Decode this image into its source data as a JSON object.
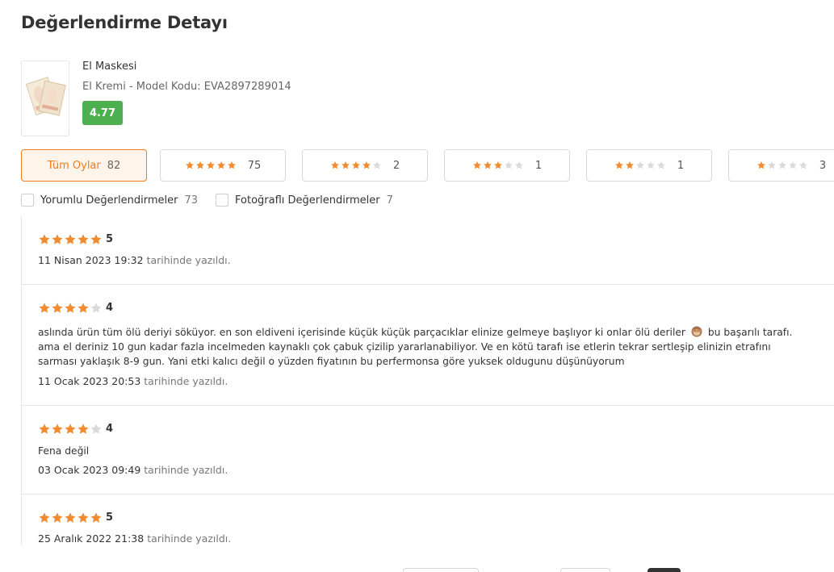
{
  "page": {
    "title": "Değerlendirme Detayı"
  },
  "product": {
    "name": "El Maskesi",
    "subtitle": "El Kremi - Model Kodu: EVA2897289014",
    "rating": "4.77"
  },
  "filters": {
    "all_label": "Tüm Oylar",
    "all_count": "82",
    "star_filters": [
      {
        "stars": 5,
        "count": "75"
      },
      {
        "stars": 4,
        "count": "2"
      },
      {
        "stars": 3,
        "count": "1"
      },
      {
        "stars": 2,
        "count": "1"
      },
      {
        "stars": 1,
        "count": "3"
      }
    ]
  },
  "checkboxes": {
    "comments_label": "Yorumlu Değerlendirmeler",
    "comments_count": "73",
    "photos_label": "Fotoğraflı Değerlendirmeler",
    "photos_count": "7"
  },
  "reviews": [
    {
      "stars": 5,
      "score": "5",
      "lines": [],
      "date": "11 Nisan 2023 19:32",
      "date_suffix": "tarihinde yazıldı."
    },
    {
      "stars": 4,
      "score": "4",
      "lines": [
        "aslında ürün tüm ölü deriyi söküyor. en son eldiveni içerisinde küçük küçük parçacıklar elinize gelmeye başlıyor ki onlar ölü deriler",
        "ama el deriniz 10 gun kadar fazla incelmeden kaynaklı çok çabuk çizilip yararlanabiliyor. Ve en kötü tarafı ise etlerin tekrar sertleşip elinizin etrafını",
        "sarması yaklaşık 8-9 gun. Yani etki kalıcı değil o yüzden fiyatının bu perfermonsa göre yuksek oldugunu düşünüyorum"
      ],
      "line1_tail": "bu başarılı tarafı.",
      "date": "11 Ocak 2023 20:53",
      "date_suffix": "tarihinde yazıldı."
    },
    {
      "stars": 4,
      "score": "4",
      "lines": [
        "Fena değil"
      ],
      "date": "03 Ocak 2023 09:49",
      "date_suffix": "tarihinde yazıldı."
    },
    {
      "stars": 5,
      "score": "5",
      "lines": [],
      "date": "25 Aralık 2022 21:38",
      "date_suffix": "tarihinde yazıldı."
    }
  ],
  "colors": {
    "accent": "#f27a1a",
    "star": "#f28b30",
    "badge": "#4caf50"
  }
}
